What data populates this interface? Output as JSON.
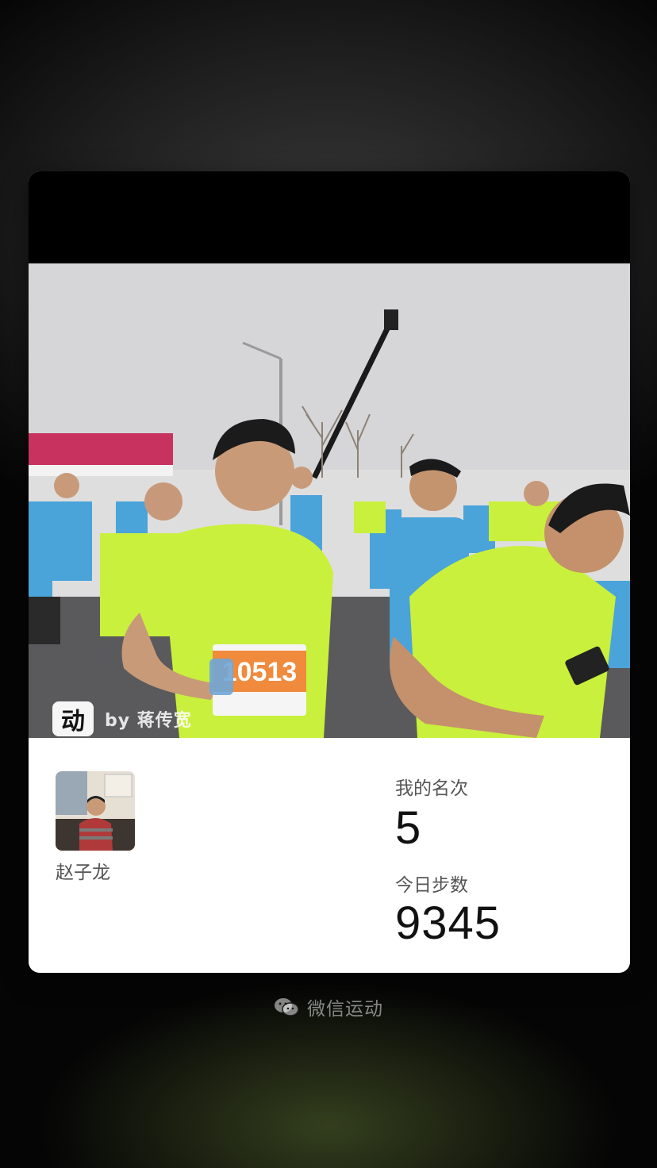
{
  "photo": {
    "bib_number": "10513",
    "watermark_logo": "动",
    "watermark_text": "by 蒋传宽"
  },
  "user": {
    "name": "赵子龙",
    "avatar_icon": "avatar"
  },
  "stats": {
    "rank_label": "我的名次",
    "rank_value": "5",
    "steps_label": "今日步数",
    "steps_value": "9345"
  },
  "footer": {
    "icon": "wechat-icon",
    "text": "微信运动"
  },
  "colors": {
    "card_bg": "#ffffff",
    "jersey_yellow": "#c9f03c",
    "jersey_blue": "#4aa3d9",
    "sky": "#dcdcdc"
  }
}
